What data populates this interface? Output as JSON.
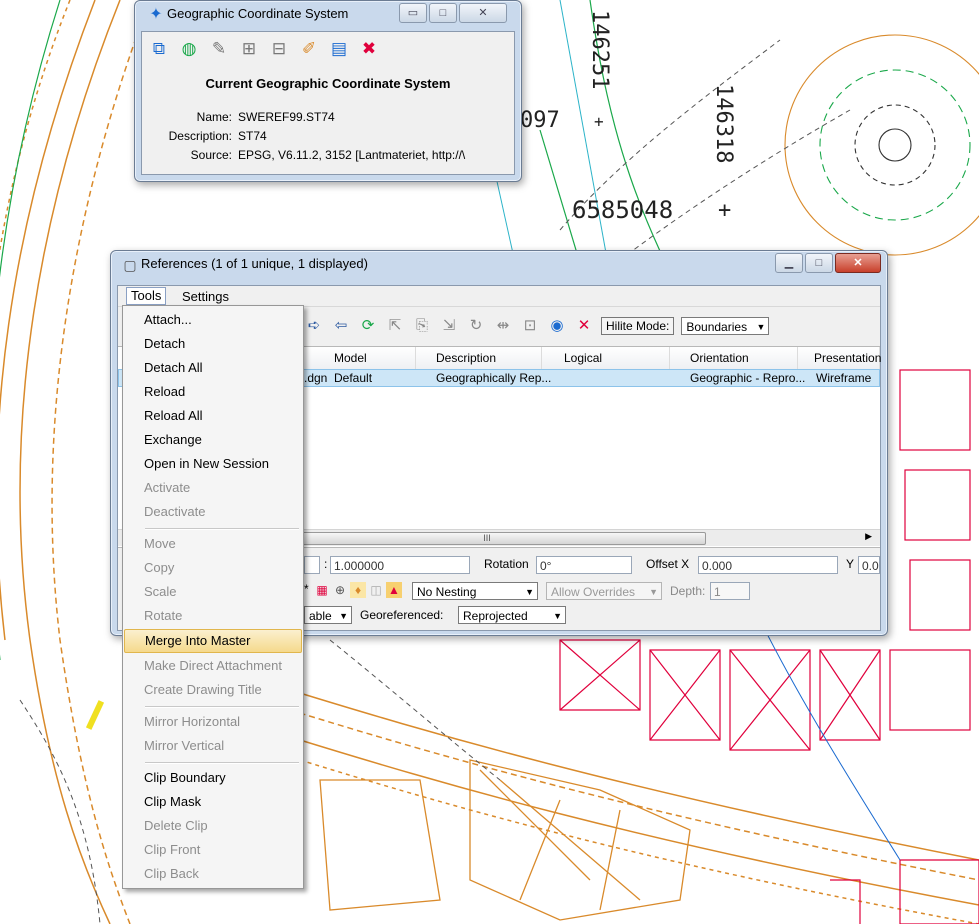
{
  "map_labels": {
    "n1": "146251",
    "n2": "097",
    "n3": "146318",
    "n4": "6585048",
    "plus": "+"
  },
  "gcs_window": {
    "title": "Geographic Coordinate System",
    "heading": "Current Geographic Coordinate System",
    "name_label": "Name:",
    "name_value": "SWEREF99.ST74",
    "description_label": "Description:",
    "description_value": "ST74",
    "source_label": "Source:",
    "source_value": "EPSG, V6.11.2, 3152 [Lantmateriet, http://\\"
  },
  "references_window": {
    "title": "References (1 of 1 unique, 1 displayed)",
    "menu": {
      "tools": "Tools",
      "settings": "Settings"
    },
    "hilite_mode_label": "Hilite Mode:",
    "hilite_mode_value": "Boundaries",
    "columns": [
      "Model",
      "Description",
      "Logical",
      "Orientation",
      "Presentation"
    ],
    "row": {
      "file": ".dgn",
      "model": "Default",
      "description": "Geographically Rep...",
      "logical": "",
      "orientation": "Geographic - Repro...",
      "presentation": "Wireframe"
    },
    "scroll_mark": "III",
    "scale_value": "1.000000",
    "rotation_label": "Rotation",
    "rotation_value": "0°",
    "offset_x_label": "Offset X",
    "offset_x_value": "0.000",
    "y_label": "Y",
    "y_value": "0.0",
    "nesting_value": "No Nesting",
    "allow_overrides_value": "Allow Overrides",
    "depth_label": "Depth:",
    "depth_value": "1",
    "display_value": "able",
    "georeferenced_label": "Georeferenced:",
    "georeferenced_value": "Reprojected"
  },
  "tools_menu": {
    "items": [
      {
        "label": "Attach...",
        "enabled": true
      },
      {
        "label": "Detach",
        "enabled": true
      },
      {
        "label": "Detach All",
        "enabled": true
      },
      {
        "label": "Reload",
        "enabled": true
      },
      {
        "label": "Reload All",
        "enabled": true
      },
      {
        "label": "Exchange",
        "enabled": true
      },
      {
        "label": "Open in New Session",
        "enabled": true
      },
      {
        "label": "Activate",
        "enabled": false
      },
      {
        "label": "Deactivate",
        "enabled": false
      },
      {
        "label": "Move",
        "enabled": false
      },
      {
        "label": "Copy",
        "enabled": false
      },
      {
        "label": "Scale",
        "enabled": false
      },
      {
        "label": "Rotate",
        "enabled": false
      },
      {
        "label": "Merge Into Master",
        "enabled": true,
        "highlighted": true
      },
      {
        "label": "Make Direct Attachment",
        "enabled": false
      },
      {
        "label": "Create Drawing Title",
        "enabled": false
      },
      {
        "label": "Mirror Horizontal",
        "enabled": false
      },
      {
        "label": "Mirror Vertical",
        "enabled": false
      },
      {
        "label": "Clip Boundary",
        "enabled": true
      },
      {
        "label": "Clip Mask",
        "enabled": true
      },
      {
        "label": "Delete Clip",
        "enabled": false
      },
      {
        "label": "Clip Front",
        "enabled": false
      },
      {
        "label": "Clip Back",
        "enabled": false
      }
    ]
  },
  "colors": {
    "map_red": "#e0003c",
    "map_orange": "#d98a2b",
    "map_green": "#1aa84a",
    "map_blue": "#1a6ad0",
    "map_cyan": "#2bb3c8",
    "menu_highlight": "#f5d98c"
  }
}
